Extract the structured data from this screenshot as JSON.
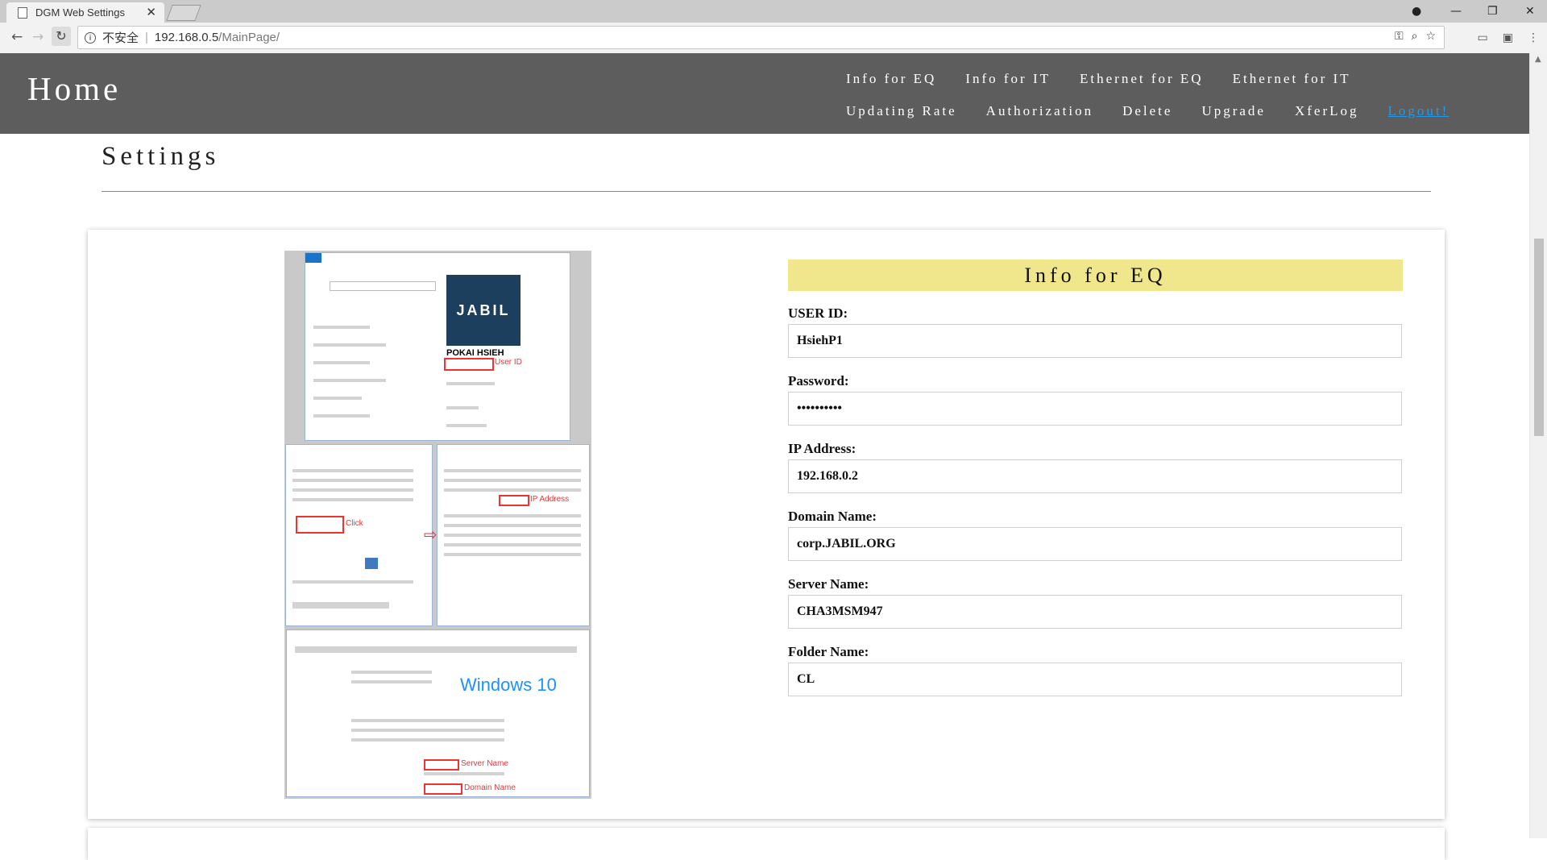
{
  "browser": {
    "tab_title": "DGM Web Settings",
    "security_label": "不安全",
    "url_host": "192.168.0.5",
    "url_path": "/MainPage/"
  },
  "header": {
    "title": "Home",
    "nav_row1": [
      "Info for EQ",
      "Info for IT",
      "Ethernet for EQ",
      "Ethernet for IT"
    ],
    "nav_row2": [
      "Updating Rate",
      "Authorization",
      "Delete",
      "Upgrade",
      "XferLog"
    ],
    "logout": "Logout!"
  },
  "page": {
    "section_title": "Settings"
  },
  "reference_image": {
    "labels": {
      "jabil_logo": "JABIL",
      "user_name": "POKAI HSIEH",
      "user_id_note": "User ID",
      "click_note": "Click",
      "ip_note": "IP Address",
      "server_note": "Server Name",
      "domain_note": "Domain Name",
      "windows_logo": "Windows 10"
    }
  },
  "form": {
    "title": "Info for EQ",
    "fields": [
      {
        "label": "USER ID:",
        "value": "HsiehP1",
        "type": "text"
      },
      {
        "label": "Password:",
        "value": "••••••••••",
        "type": "password"
      },
      {
        "label": "IP Address:",
        "value": "192.168.0.2",
        "type": "text"
      },
      {
        "label": "Domain Name:",
        "value": "corp.JABIL.ORG",
        "type": "text"
      },
      {
        "label": "Server Name:",
        "value": "CHA3MSM947",
        "type": "text"
      },
      {
        "label": "Folder Name:",
        "value": "CL",
        "type": "text"
      }
    ]
  }
}
